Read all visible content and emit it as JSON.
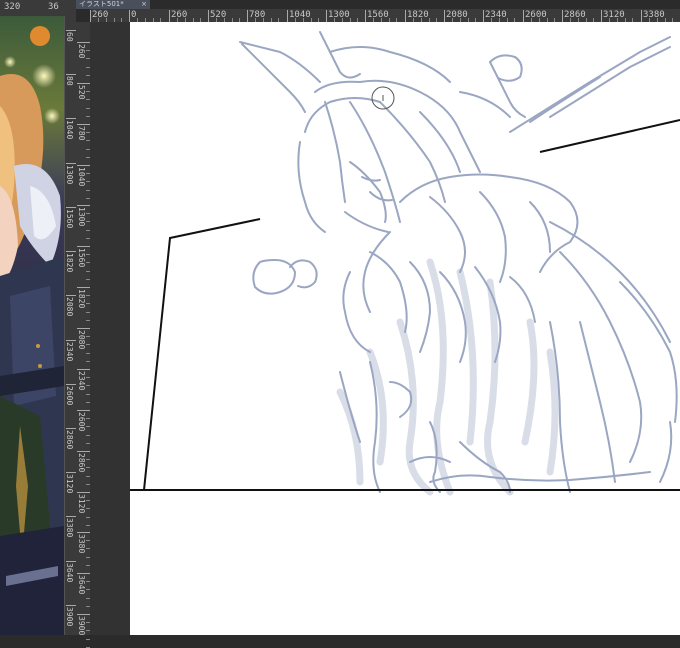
{
  "document_tab": {
    "title": "イラスト501*",
    "close_glyph": "×"
  },
  "reference_ruler_top": [
    "320",
    "36"
  ],
  "reference_ruler_left": [
    "60",
    "80",
    "1040",
    "1300",
    "1560",
    "1820",
    "2080",
    "2340",
    "2600",
    "2860",
    "3120",
    "3380",
    "3640",
    "3900"
  ],
  "main_ruler_top": [
    "260",
    "0",
    "260",
    "520",
    "780",
    "1040",
    "1300",
    "1560",
    "1820",
    "2080",
    "2340",
    "2600",
    "2860",
    "3120",
    "3380"
  ],
  "main_ruler_left": [
    "260",
    "520",
    "780",
    "1040",
    "1300",
    "1560",
    "1820",
    "2080",
    "2340",
    "2600",
    "2860",
    "3120",
    "3380",
    "3640",
    "3900"
  ],
  "colors": {
    "sketch_line": "#9aa6c2",
    "sketch_faint": "#c5ccdc",
    "panel_border": "#111111",
    "ruler_bg": "#3a3a3a",
    "tab_bg": "#4a4f5c"
  },
  "icons": {
    "brush_cursor": "circle-brush-cursor-icon"
  }
}
